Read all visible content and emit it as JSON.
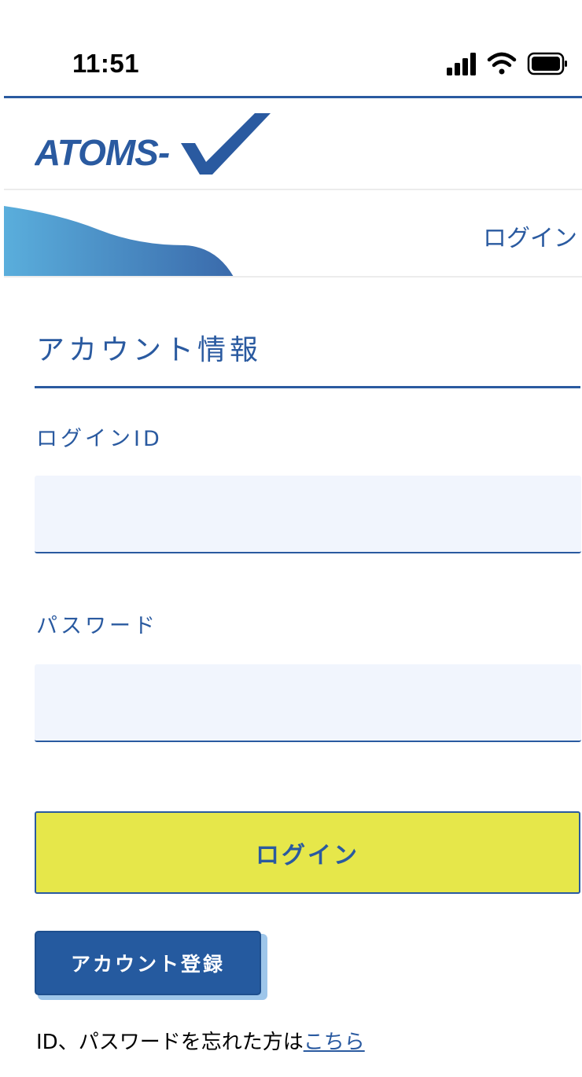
{
  "status_bar": {
    "time": "11:51",
    "icons": [
      "cellular-signal-icon",
      "wifi-icon",
      "battery-icon"
    ]
  },
  "logo": {
    "text": "ATOMS-V",
    "color": "#2a5aa0"
  },
  "header": {
    "login_link": "ログイン"
  },
  "section": {
    "title": "アカウント情報"
  },
  "form": {
    "login_id_label": "ログインID",
    "login_id_value": "",
    "password_label": "パスワード",
    "password_value": "",
    "login_button": "ログイン",
    "register_button": "アカウント登録"
  },
  "forgot": {
    "text": "ID、パスワードを忘れた方は",
    "link": "こちら"
  },
  "colors": {
    "brand_blue": "#2a5aa0",
    "login_button_bg": "#e6e74a",
    "input_bg": "#f1f5fd",
    "register_bg": "#255a9f"
  }
}
